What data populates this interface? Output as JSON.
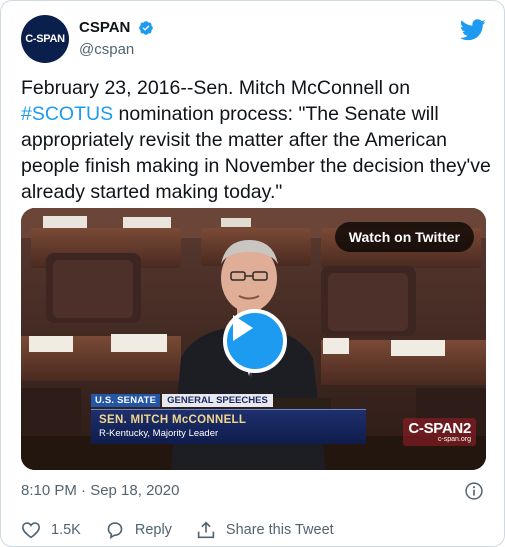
{
  "header": {
    "avatar_text": "C-SPAN",
    "display_name": "CSPAN",
    "handle": "@cspan",
    "verified": true
  },
  "tweet": {
    "text_before": "February 23, 2016--Sen. Mitch McConnell on ",
    "hashtag": "#SCOTUS",
    "text_after": " nomination process: \"The Senate will appropriately revisit the matter after the American people finish making in November the decision they've already started making today.\""
  },
  "media": {
    "watch_label": "Watch on Twitter",
    "lower_third": {
      "channel": "U.S. SENATE",
      "category": "GENERAL SPEECHES",
      "name": "SEN. MITCH McCONNELL",
      "subtitle": "R-Kentucky, Majority Leader"
    },
    "logo": {
      "main": "C-SPAN2",
      "sub": "c-span.org"
    }
  },
  "meta": {
    "timestamp": "8:10 PM · Sep 18, 2020"
  },
  "actions": {
    "likes": "1.5K",
    "reply_label": "Reply",
    "share_label": "Share this Tweet"
  },
  "colors": {
    "accent": "#1d9bf0",
    "text": "#0f1419",
    "secondary": "#536471"
  }
}
